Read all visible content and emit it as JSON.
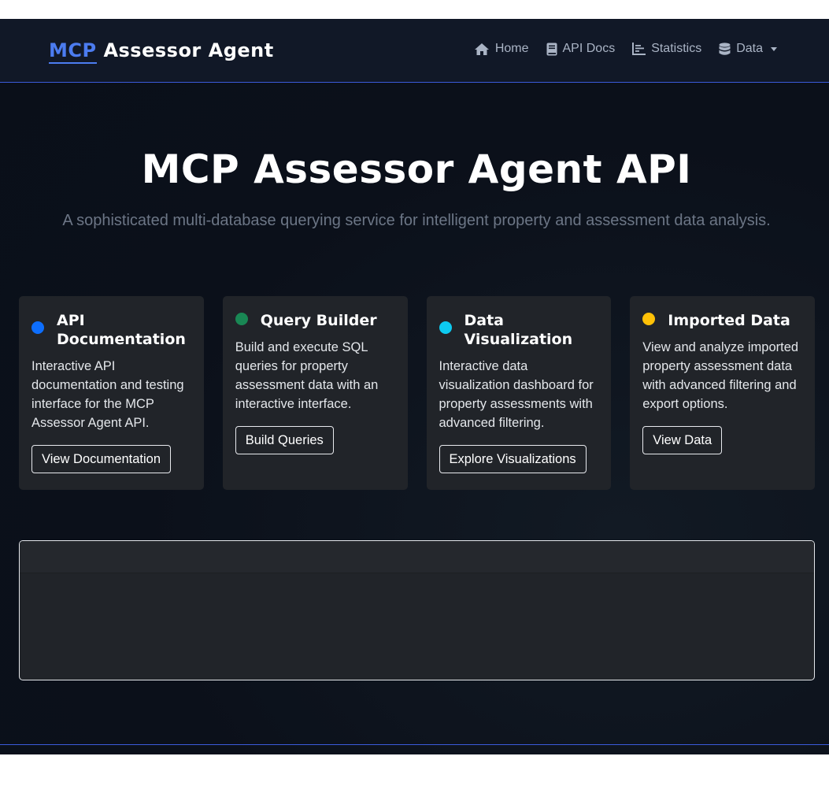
{
  "navbar": {
    "brand_accent": "MCP",
    "brand_rest": " Assessor Agent",
    "links": [
      {
        "label": "Home",
        "icon": "home-icon"
      },
      {
        "label": "API Docs",
        "icon": "book-icon"
      },
      {
        "label": "Statistics",
        "icon": "bar-chart-icon"
      },
      {
        "label": "Data",
        "icon": "database-icon",
        "dropdown": true
      }
    ]
  },
  "hero": {
    "title": "MCP Assessor Agent API",
    "subtitle": "A sophisticated multi-database querying service for intelligent property and assessment data analysis."
  },
  "cards": [
    {
      "title_line1": "API",
      "title_line2": "Documentation",
      "dot_color": "#0d6efd",
      "text": "Interactive API documentation and testing interface for the MCP Assessor Agent API.",
      "button": "View Documentation"
    },
    {
      "title_line1": "Query Builder",
      "title_line2": "",
      "dot_color": "#198754",
      "text": "Build and execute SQL queries for property assessment data with an interactive interface.",
      "button": "Build Queries"
    },
    {
      "title_line1": "Data",
      "title_line2": "Visualization",
      "dot_color": "#0dcaf0",
      "text": "Interactive data visualization dashboard for property assessments with advanced filtering.",
      "button": "Explore Visualizations"
    },
    {
      "title_line1": "Imported Data",
      "title_line2": "",
      "dot_color": "#ffc107",
      "text": "View and analyze imported property assessment data with advanced filtering and export options.",
      "button": "View Data"
    }
  ],
  "colors": {
    "accent": "#4c7cf0",
    "nav_border": "#3b5bdb",
    "card_bg": "#212429"
  }
}
